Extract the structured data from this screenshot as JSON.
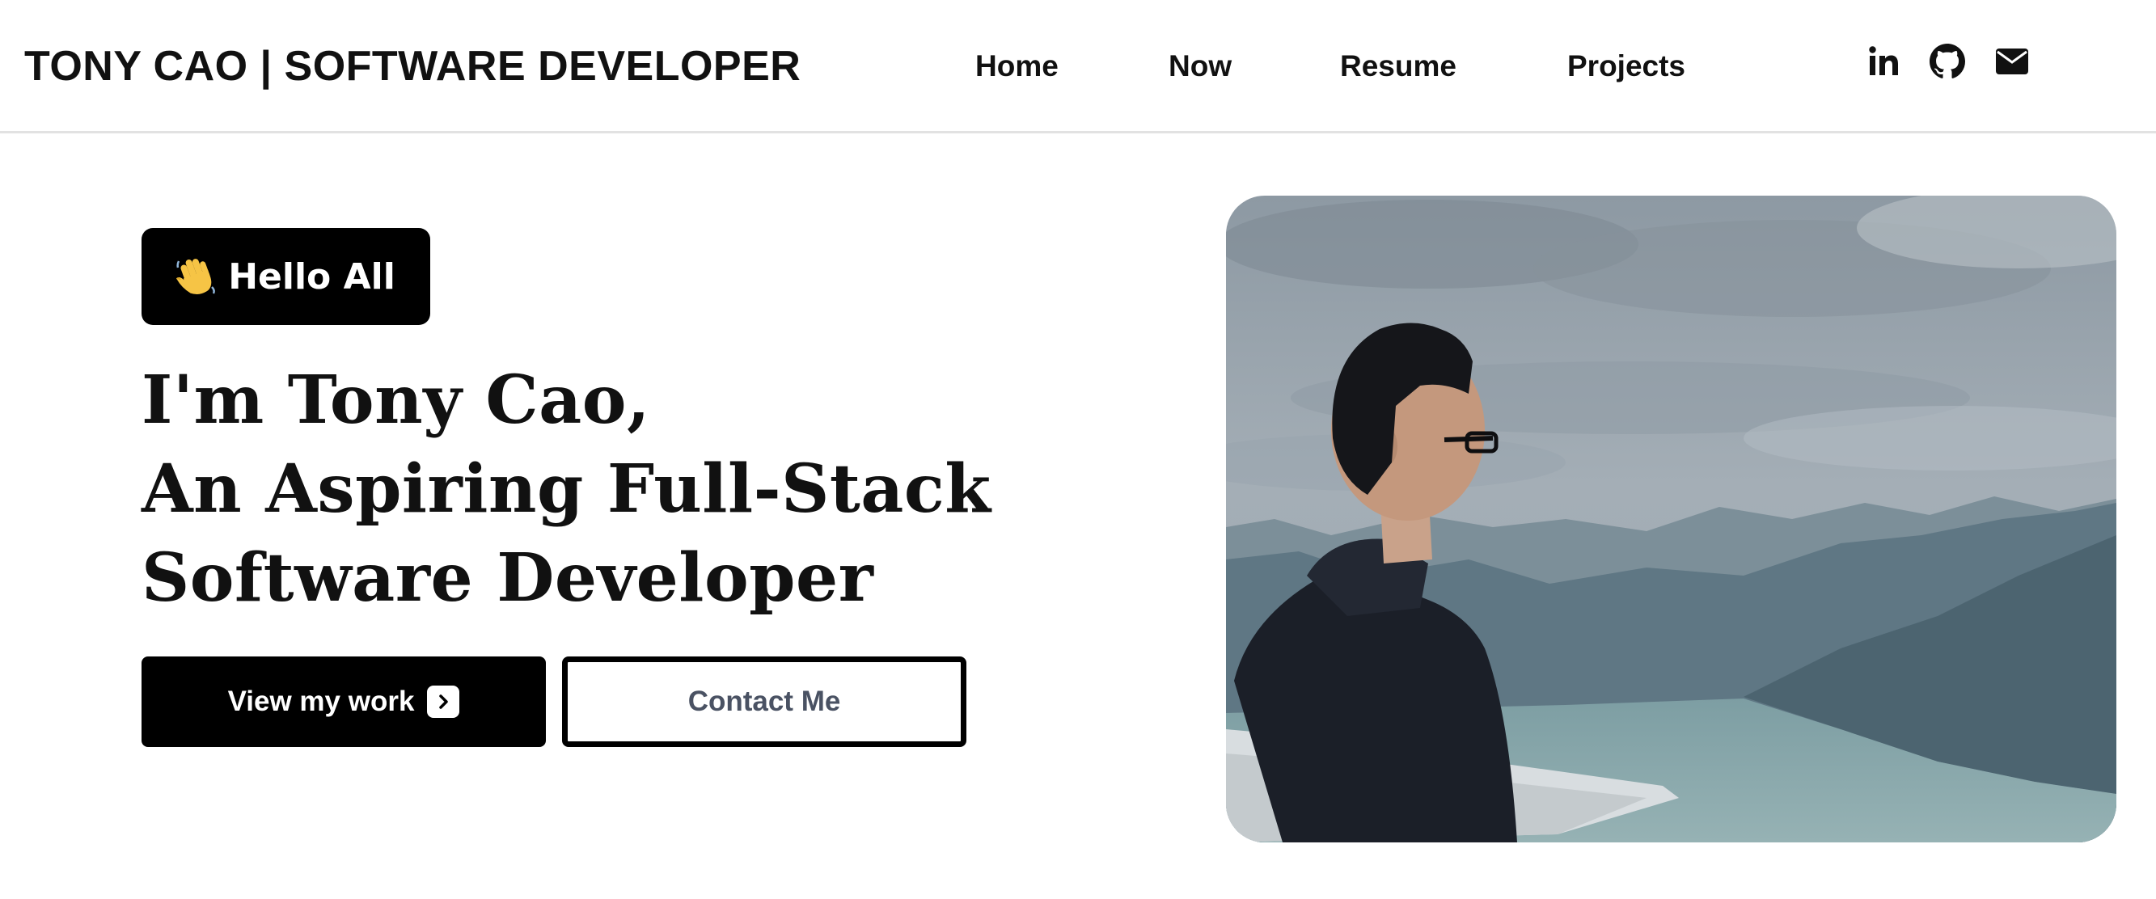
{
  "header": {
    "brand": "TONY CAO | SOFTWARE DEVELOPER",
    "nav": [
      {
        "label": "Home"
      },
      {
        "label": "Now"
      },
      {
        "label": "Resume"
      },
      {
        "label": "Projects"
      }
    ],
    "social": [
      {
        "icon": "linkedin-icon"
      },
      {
        "icon": "github-icon"
      },
      {
        "icon": "mail-icon"
      }
    ]
  },
  "hero": {
    "badge": {
      "icon": "waving-hand-icon",
      "label": "Hello All"
    },
    "headline": [
      "I'm Tony Cao,",
      "An Aspiring Full-Stack",
      "Software Developer"
    ],
    "primary_button": {
      "label": "View my work",
      "icon": "chevron-right-icon"
    },
    "secondary_button": {
      "label": "Contact Me"
    },
    "photo": {
      "subject": "man in hooded jacket looking over mountains and lake under cloudy sky"
    }
  },
  "colors": {
    "background": "#ffffff",
    "text": "#111111",
    "primary_button_bg": "#000000",
    "secondary_button_text": "#4a5263",
    "divider": "#e2e2e2"
  }
}
